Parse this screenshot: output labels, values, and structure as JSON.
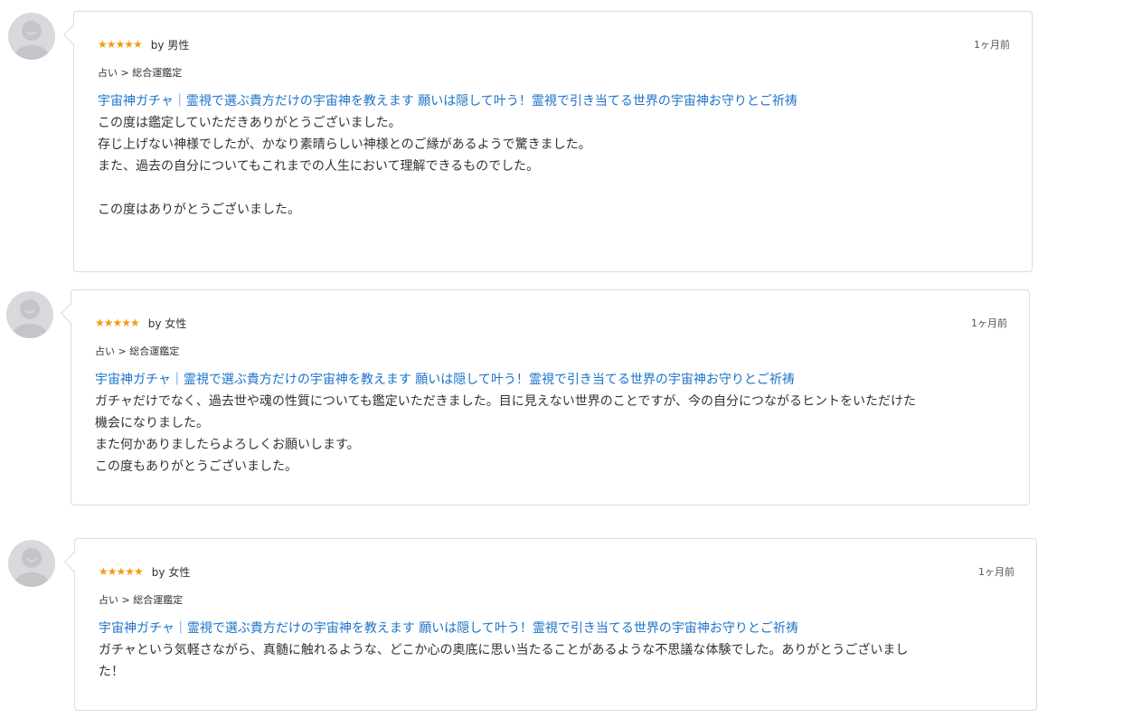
{
  "reviews": [
    {
      "stars": "★★★★★",
      "by": "by 男性",
      "date": "1ヶ月前",
      "category": "占い > 総合運鑑定",
      "title": "宇宙神ガチャ｜霊視で選ぶ貴方だけの宇宙神を教えます 願いは隠して叶う！霊視で引き当てる世界の宇宙神お守りとご祈祷",
      "body": "この度は鑑定していただきありがとうございました。\n存じ上げない神様でしたが、かなり素晴らしい神様とのご縁があるようで驚きました。\nまた、過去の自分についてもこれまでの人生において理解できるものでした。\n\nこの度はありがとうございました。"
    },
    {
      "stars": "★★★★★",
      "by": "by 女性",
      "date": "1ヶ月前",
      "category": "占い > 総合運鑑定",
      "title": "宇宙神ガチャ｜霊視で選ぶ貴方だけの宇宙神を教えます 願いは隠して叶う！霊視で引き当てる世界の宇宙神お守りとご祈祷",
      "body": "ガチャだけでなく、過去世や魂の性質についても鑑定いただきました。目に見えない世界のことですが、今の自分につながるヒントをいただけた\n機会になりました。\nまた何かありましたらよろしくお願いします。\nこの度もありがとうございました。"
    },
    {
      "stars": "★★★★★",
      "by": "by 女性",
      "date": "1ヶ月前",
      "category": "占い > 総合運鑑定",
      "title": "宇宙神ガチャ｜霊視で選ぶ貴方だけの宇宙神を教えます 願いは隠して叶う！霊視で引き当てる世界の宇宙神お守りとご祈祷",
      "body": "ガチャという気軽さながら、真髄に触れるような、どこか心の奥底に思い当たることがあるような不思議な体験でした。ありがとうございまし\nた！"
    }
  ],
  "colors": {
    "star": "#f39c12",
    "link": "#1a73c9",
    "border": "#dcdcdc",
    "avatar": "#d8d9dc"
  },
  "icons": {
    "avatar": "default-user-avatar-icon",
    "rating": "star-icon"
  }
}
